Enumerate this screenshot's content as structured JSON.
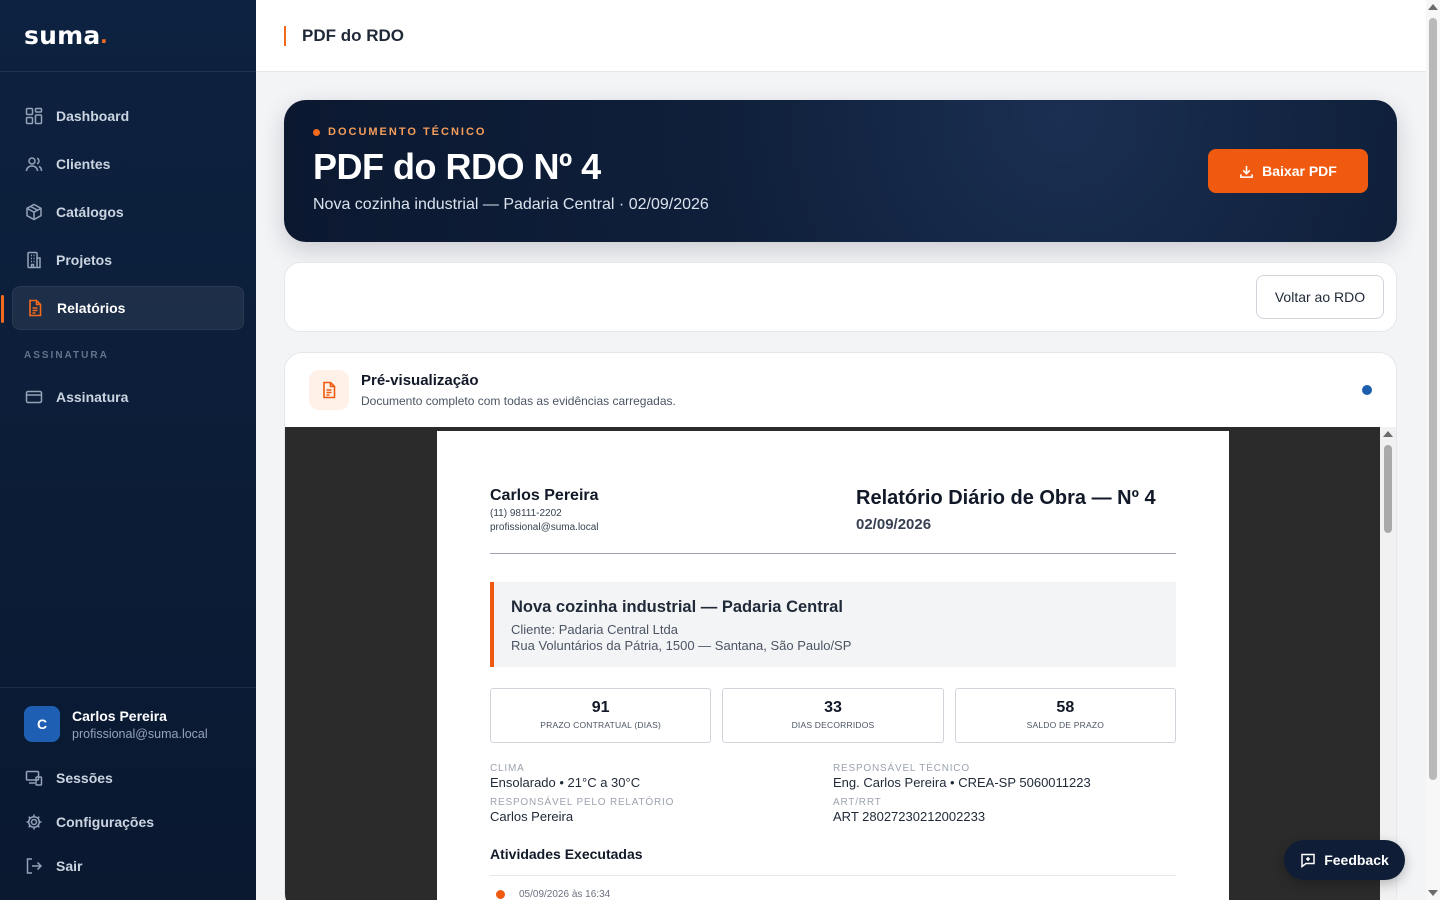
{
  "brand": {
    "name": "suma",
    "dot": "."
  },
  "sidebar": {
    "items": [
      {
        "label": "Dashboard",
        "icon": "dashboard-icon"
      },
      {
        "label": "Clientes",
        "icon": "users-icon"
      },
      {
        "label": "Catálogos",
        "icon": "box-icon"
      },
      {
        "label": "Projetos",
        "icon": "building-icon"
      },
      {
        "label": "Relatórios",
        "icon": "document-icon",
        "active": true
      }
    ],
    "section_label": "ASSINATURA",
    "subscription_item": {
      "label": "Assinatura",
      "icon": "card-icon"
    },
    "user": {
      "initial": "C",
      "name": "Carlos Pereira",
      "email": "profissional@suma.local"
    },
    "bottom_items": [
      {
        "label": "Sessões",
        "icon": "devices-icon"
      },
      {
        "label": "Configurações",
        "icon": "gear-icon"
      },
      {
        "label": "Sair",
        "icon": "logout-icon"
      }
    ]
  },
  "topbar": {
    "title": "PDF do RDO"
  },
  "hero": {
    "eyebrow": "DOCUMENTO TÉCNICO",
    "title": "PDF do RDO Nº 4",
    "subtitle": "Nova cozinha industrial — Padaria Central · 02/09/2026",
    "download_label": "Baixar PDF"
  },
  "actions": {
    "back_label": "Voltar ao RDO"
  },
  "preview": {
    "title": "Pré-visualização",
    "subtitle": "Documento completo com todas as evidências carregadas."
  },
  "pdf": {
    "author_name": "Carlos Pereira",
    "author_phone": "(11) 98111-2202",
    "author_email": "profissional@suma.local",
    "doc_title": "Relatório Diário de Obra — Nº 4",
    "doc_date": "02/09/2026",
    "project_name": "Nova cozinha industrial — Padaria Central",
    "project_client": "Cliente: Padaria Central Ltda",
    "project_address": "Rua Voluntários da Pátria, 1500 — Santana, São Paulo/SP",
    "stats": [
      {
        "value": "91",
        "label": "PRAZO CONTRATUAL (DIAS)"
      },
      {
        "value": "33",
        "label": "DIAS DECORRIDOS"
      },
      {
        "value": "58",
        "label": "SALDO DE PRAZO"
      }
    ],
    "info": [
      {
        "label": "CLIMA",
        "value": "Ensolarado • 21°C a 30°C"
      },
      {
        "label": "RESPONSÁVEL TÉCNICO",
        "value": "Eng. Carlos Pereira • CREA-SP 5060011223"
      },
      {
        "label": "RESPONSÁVEL PELO RELATÓRIO",
        "value": "Carlos Pereira"
      },
      {
        "label": "ART/RRT",
        "value": "ART 28027230212002233"
      }
    ],
    "activities_title": "Atividades Executadas",
    "activity_time": "05/09/2026 às 16:34"
  },
  "feedback": {
    "label": "Feedback"
  },
  "colors": {
    "accent": "#ef5a10",
    "navy": "#0d2240",
    "status_blue": "#1d5fae"
  }
}
